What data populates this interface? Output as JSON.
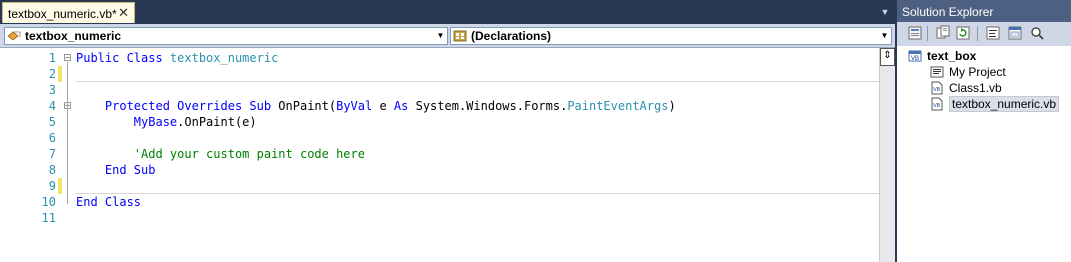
{
  "editor": {
    "tab": {
      "label": "textbox_numeric.vb*",
      "close": "✕"
    },
    "nav": {
      "left_combo": "textbox_numeric",
      "right_combo": "(Declarations)"
    },
    "code_lines": [
      {
        "n": "1",
        "tokens": [
          {
            "c": "kw",
            "t": "Public Class "
          },
          {
            "c": "ty",
            "t": "textbox_numeric"
          }
        ]
      },
      {
        "n": "2",
        "tokens": []
      },
      {
        "n": "3",
        "tokens": []
      },
      {
        "n": "4",
        "tokens": [
          {
            "c": "pl",
            "t": "    "
          },
          {
            "c": "kw",
            "t": "Protected Overrides Sub "
          },
          {
            "c": "pl",
            "t": "OnPaint("
          },
          {
            "c": "kw",
            "t": "ByVal "
          },
          {
            "c": "pl",
            "t": "e "
          },
          {
            "c": "kw",
            "t": "As "
          },
          {
            "c": "pl",
            "t": "System.Windows.Forms."
          },
          {
            "c": "ty",
            "t": "PaintEventArgs"
          },
          {
            "c": "pl",
            "t": ")"
          }
        ]
      },
      {
        "n": "5",
        "tokens": [
          {
            "c": "pl",
            "t": "        "
          },
          {
            "c": "kw",
            "t": "MyBase"
          },
          {
            "c": "pl",
            "t": ".OnPaint(e)"
          }
        ]
      },
      {
        "n": "6",
        "tokens": []
      },
      {
        "n": "7",
        "tokens": [
          {
            "c": "pl",
            "t": "        "
          },
          {
            "c": "cm",
            "t": "'Add your custom paint code here"
          }
        ]
      },
      {
        "n": "8",
        "tokens": [
          {
            "c": "pl",
            "t": "    "
          },
          {
            "c": "kw",
            "t": "End Sub"
          }
        ]
      },
      {
        "n": "9",
        "tokens": []
      },
      {
        "n": "10",
        "tokens": [
          {
            "c": "kw",
            "t": "End Class"
          }
        ]
      },
      {
        "n": "11",
        "tokens": []
      }
    ],
    "changed_lines": [
      "2",
      "9"
    ],
    "colors": {
      "changed_marker": "#f5e36c",
      "keyword": "#0000ff",
      "type": "#2b91af",
      "comment": "#008000",
      "line_number": "#2b91af"
    }
  },
  "solution_explorer": {
    "title": "Solution Explorer",
    "toolbar_icons": [
      "properties-icon",
      "show-all-files-icon",
      "refresh-icon",
      "view-code-icon",
      "view-designer-icon",
      "class-view-icon"
    ],
    "tree": [
      {
        "label": "text_box",
        "icon": "vb-project-icon",
        "bold": true,
        "level": 0
      },
      {
        "label": "My Project",
        "icon": "my-project-icon",
        "bold": false,
        "level": 1
      },
      {
        "label": "Class1.vb",
        "icon": "vb-file-icon",
        "bold": false,
        "level": 1
      },
      {
        "label": "textbox_numeric.vb",
        "icon": "vb-file-icon",
        "bold": false,
        "level": 1,
        "selected": true
      }
    ]
  }
}
